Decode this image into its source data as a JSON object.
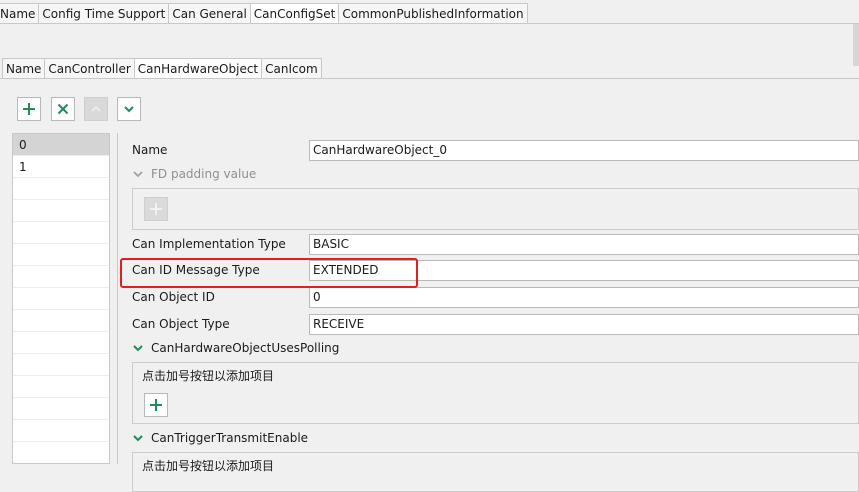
{
  "top_tabs": [
    "Name",
    "Config Time Support",
    "Can General",
    "CanConfigSet",
    "CommonPublishedInformation"
  ],
  "sub_tabs": [
    "Name",
    "CanController",
    "CanHardwareObject",
    "CanIcom"
  ],
  "list_items": [
    "0",
    "1"
  ],
  "form": {
    "name_label": "Name",
    "name_value": "CanHardwareObject_0",
    "fd_padding_title": "FD padding value",
    "impl_type_label": "Can Implementation Type",
    "impl_type_value": "BASIC",
    "id_msg_type_label": "Can ID Message Type",
    "id_msg_type_value": "EXTENDED",
    "object_id_label": "Can Object ID",
    "object_id_value": "0",
    "object_type_label": "Can Object Type",
    "object_type_value": "RECEIVE",
    "uses_polling_title": "CanHardwareObjectUsesPolling",
    "uses_polling_hint": "点击加号按钮以添加项目",
    "trigger_title": "CanTriggerTransmitEnable",
    "trigger_hint": "点击加号按钮以添加项目"
  },
  "colors": {
    "accent_green": "#1f8a5a",
    "highlight_red": "#e02020"
  }
}
